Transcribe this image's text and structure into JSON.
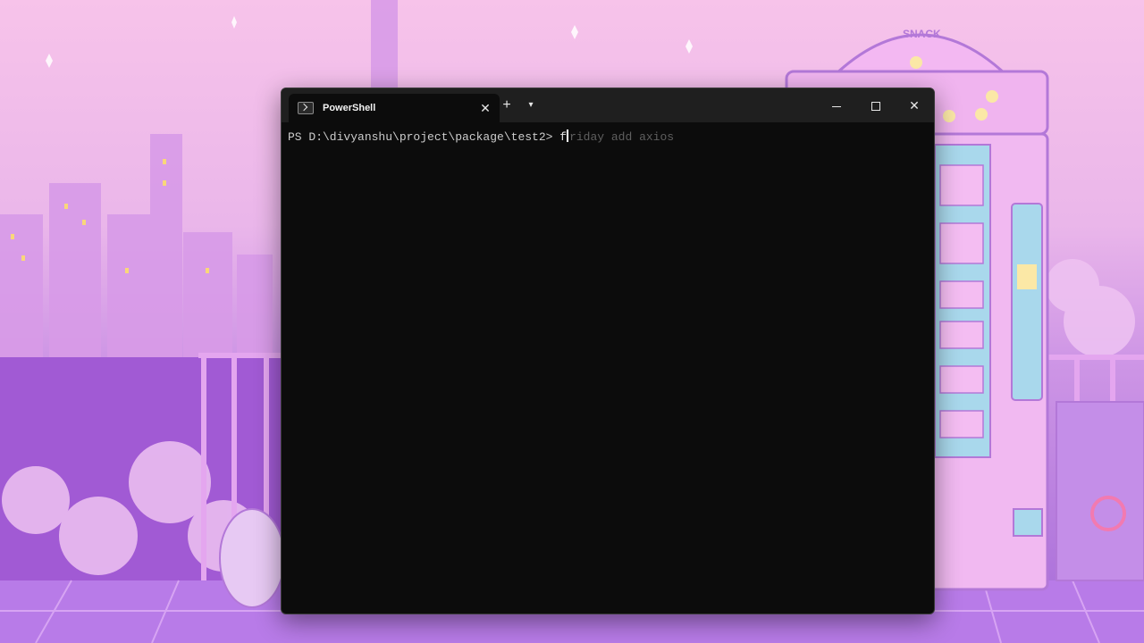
{
  "window": {
    "tab_title": "PowerShell",
    "tab_icon": "powershell-icon",
    "new_tab_icon": "plus-icon",
    "dropdown_icon": "chevron-down-icon",
    "minimize_icon": "minimize-icon",
    "maximize_icon": "maximize-icon",
    "close_icon": "close-icon"
  },
  "console": {
    "prompt": "PS D:\\divyanshu\\project\\package\\test2> ",
    "typed": "f",
    "suggestion": "riday add axios"
  },
  "wallpaper": {
    "sign_text": "SNACK",
    "colors": {
      "sky_top": "#f7c3ea",
      "city": "#b87ee0",
      "floor": "#b06ee6",
      "machine": "#f1b9f1"
    }
  }
}
